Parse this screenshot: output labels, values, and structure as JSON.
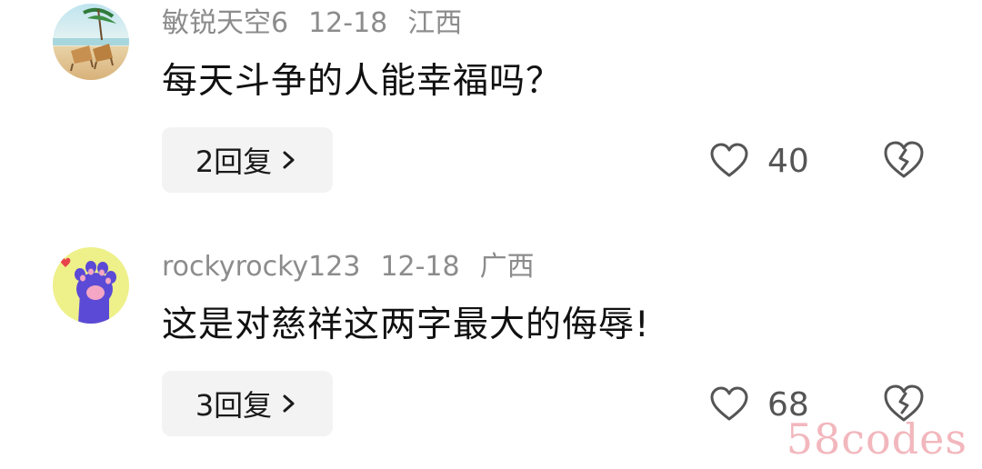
{
  "comments": [
    {
      "username": "敏锐天空6",
      "date": "12-18",
      "location": "江西",
      "text": "每天斗争的人能幸福吗？",
      "reply_label": "2回复",
      "like_count": "40",
      "avatar_icon": "beach-chairs-avatar"
    },
    {
      "username": "rockyrocky123",
      "date": "12-18",
      "location": "广西",
      "text": "这是对慈祥这两字最大的侮辱!",
      "reply_label": "3回复",
      "like_count": "68",
      "avatar_icon": "cat-paw-avatar"
    }
  ],
  "watermark": "58codes",
  "colors": {
    "meta_text": "#8c8c8c",
    "body_text": "#111111",
    "reply_bg": "#f3f3f3",
    "icon_stroke": "#555555",
    "watermark": "#f2b7bd"
  }
}
